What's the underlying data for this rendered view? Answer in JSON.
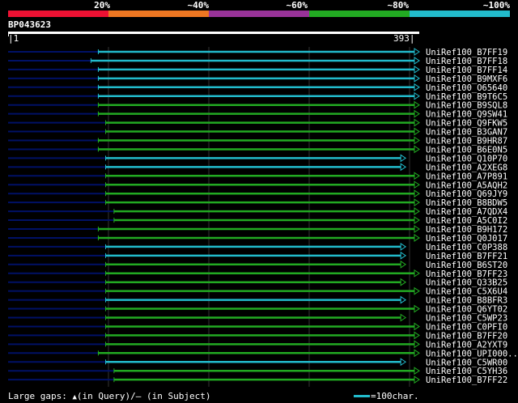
{
  "scale": {
    "labels": [
      "20%",
      "~40%",
      "~60%",
      "~80%",
      "~100%"
    ],
    "colors": [
      "#ee1133",
      "#ee7722",
      "#993399",
      "#22aa22",
      "#22bbcc"
    ]
  },
  "query": {
    "name": "BP043623",
    "start": "1",
    "end": "393"
  },
  "colors": {
    "match_cyan": "#22bbcc",
    "match_green": "#22aa22",
    "gap_navy": "#001166",
    "grid": "#333333"
  },
  "hits": [
    {
      "label": "UniRef100_B7FF19",
      "start": 87,
      "end": 393,
      "color": "cyan"
    },
    {
      "label": "UniRef100_B7FF18",
      "start": 80,
      "end": 393,
      "color": "cyan"
    },
    {
      "label": "UniRef100_B7FF14",
      "start": 87,
      "end": 393,
      "color": "cyan"
    },
    {
      "label": "UniRef100_B9MXF6",
      "start": 87,
      "end": 393,
      "color": "cyan"
    },
    {
      "label": "UniRef100_O65640",
      "start": 87,
      "end": 393,
      "color": "cyan"
    },
    {
      "label": "UniRef100_B9T6C5",
      "start": 87,
      "end": 393,
      "color": "cyan"
    },
    {
      "label": "UniRef100_B9SQL8",
      "start": 87,
      "end": 393,
      "color": "green"
    },
    {
      "label": "UniRef100_Q9SW41",
      "start": 87,
      "end": 393,
      "color": "green"
    },
    {
      "label": "UniRef100_Q9FKW5",
      "start": 94,
      "end": 393,
      "color": "green"
    },
    {
      "label": "UniRef100_B3GAN7",
      "start": 94,
      "end": 393,
      "color": "green"
    },
    {
      "label": "UniRef100_B9HR87",
      "start": 87,
      "end": 393,
      "color": "green"
    },
    {
      "label": "UniRef100_B6E0N5",
      "start": 87,
      "end": 393,
      "color": "green"
    },
    {
      "label": "UniRef100_Q10P70",
      "start": 94,
      "end": 380,
      "color": "cyan"
    },
    {
      "label": "UniRef100_A2XEG8",
      "start": 94,
      "end": 380,
      "color": "cyan"
    },
    {
      "label": "UniRef100_A7P891",
      "start": 94,
      "end": 393,
      "color": "green"
    },
    {
      "label": "UniRef100_A5AQH2",
      "start": 94,
      "end": 393,
      "color": "green"
    },
    {
      "label": "UniRef100_Q69JY9",
      "start": 94,
      "end": 393,
      "color": "green"
    },
    {
      "label": "UniRef100_B8BDW5",
      "start": 94,
      "end": 393,
      "color": "green"
    },
    {
      "label": "UniRef100_A7QDX4",
      "start": 102,
      "end": 393,
      "color": "green"
    },
    {
      "label": "UniRef100_A5C0I2",
      "start": 102,
      "end": 393,
      "color": "green"
    },
    {
      "label": "UniRef100_B9H172",
      "start": 87,
      "end": 393,
      "color": "green"
    },
    {
      "label": "UniRef100_Q0J017",
      "start": 87,
      "end": 393,
      "color": "green"
    },
    {
      "label": "UniRef100_C0P388",
      "start": 94,
      "end": 380,
      "color": "cyan"
    },
    {
      "label": "UniRef100_B7FF21",
      "start": 94,
      "end": 380,
      "color": "cyan"
    },
    {
      "label": "UniRef100_B6ST20",
      "start": 94,
      "end": 380,
      "color": "green"
    },
    {
      "label": "UniRef100_B7FF23",
      "start": 94,
      "end": 393,
      "color": "green"
    },
    {
      "label": "UniRef100_Q33B25",
      "start": 94,
      "end": 380,
      "color": "green"
    },
    {
      "label": "UniRef100_C5X6U4",
      "start": 94,
      "end": 393,
      "color": "green"
    },
    {
      "label": "UniRef100_B8BFR3",
      "start": 94,
      "end": 380,
      "color": "cyan"
    },
    {
      "label": "UniRef100_Q6YT02",
      "start": 94,
      "end": 393,
      "color": "green"
    },
    {
      "label": "UniRef100_C5WP23",
      "start": 94,
      "end": 380,
      "color": "green"
    },
    {
      "label": "UniRef100_C0PFI0",
      "start": 94,
      "end": 393,
      "color": "green"
    },
    {
      "label": "UniRef100_B7FF20",
      "start": 94,
      "end": 393,
      "color": "green"
    },
    {
      "label": "UniRef100_A2YXT9",
      "start": 94,
      "end": 393,
      "color": "green"
    },
    {
      "label": "UniRef100_UPI000..",
      "start": 87,
      "end": 393,
      "color": "green"
    },
    {
      "label": "UniRef100_C5WR00",
      "start": 94,
      "end": 380,
      "color": "cyan"
    },
    {
      "label": "UniRef100_C5YH36",
      "start": 102,
      "end": 393,
      "color": "green"
    },
    {
      "label": "UniRef100_B7FF22",
      "start": 102,
      "end": 393,
      "color": "green"
    }
  ],
  "legend": {
    "gaps_text": "Large gaps:",
    "in_query_text": "(in Query)/",
    "dash_text": "–",
    "in_subject_text": "(in Subject)",
    "scale_text": "=100char."
  }
}
